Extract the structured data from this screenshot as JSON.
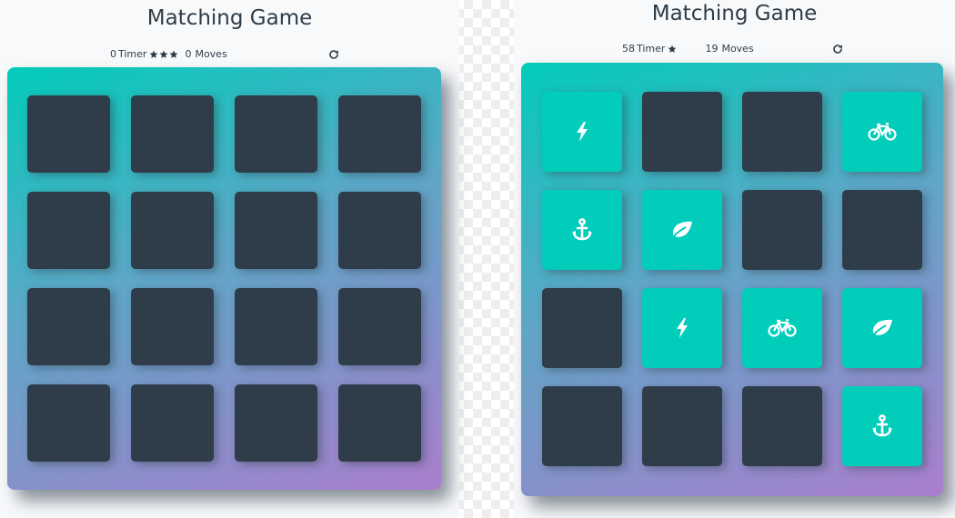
{
  "panels": [
    {
      "title": "Matching Game",
      "timer": "0",
      "timer_label": "Timer",
      "stars": 3,
      "moves": "0",
      "moves_label": "Moves",
      "cards": [
        {
          "state": "closed",
          "icon": ""
        },
        {
          "state": "closed",
          "icon": ""
        },
        {
          "state": "closed",
          "icon": ""
        },
        {
          "state": "closed",
          "icon": ""
        },
        {
          "state": "closed",
          "icon": ""
        },
        {
          "state": "closed",
          "icon": ""
        },
        {
          "state": "closed",
          "icon": ""
        },
        {
          "state": "closed",
          "icon": ""
        },
        {
          "state": "closed",
          "icon": ""
        },
        {
          "state": "closed",
          "icon": ""
        },
        {
          "state": "closed",
          "icon": ""
        },
        {
          "state": "closed",
          "icon": ""
        },
        {
          "state": "closed",
          "icon": ""
        },
        {
          "state": "closed",
          "icon": ""
        },
        {
          "state": "closed",
          "icon": ""
        },
        {
          "state": "closed",
          "icon": ""
        }
      ]
    },
    {
      "title": "Matching Game",
      "timer": "58",
      "timer_label": "Timer",
      "stars": 1,
      "moves": "19",
      "moves_label": "Moves",
      "cards": [
        {
          "state": "match",
          "icon": "bolt-icon"
        },
        {
          "state": "closed",
          "icon": ""
        },
        {
          "state": "closed",
          "icon": ""
        },
        {
          "state": "match",
          "icon": "bicycle-icon"
        },
        {
          "state": "match",
          "icon": "anchor-icon"
        },
        {
          "state": "match",
          "icon": "leaf-icon"
        },
        {
          "state": "closed",
          "icon": ""
        },
        {
          "state": "closed",
          "icon": ""
        },
        {
          "state": "closed",
          "icon": ""
        },
        {
          "state": "match",
          "icon": "bolt-icon"
        },
        {
          "state": "match",
          "icon": "bicycle-icon"
        },
        {
          "state": "match",
          "icon": "leaf-icon"
        },
        {
          "state": "closed",
          "icon": ""
        },
        {
          "state": "closed",
          "icon": ""
        },
        {
          "state": "closed",
          "icon": ""
        },
        {
          "state": "match",
          "icon": "anchor-icon"
        }
      ]
    }
  ],
  "colors": {
    "card_back": "#2e3d49",
    "card_match": "#02ccba",
    "deck_gradient_start": "#02ccba",
    "deck_gradient_end": "#aa7ecd",
    "text": "#2e3d49"
  },
  "restart_icon": "restart-icon",
  "star_icon": "star-icon"
}
